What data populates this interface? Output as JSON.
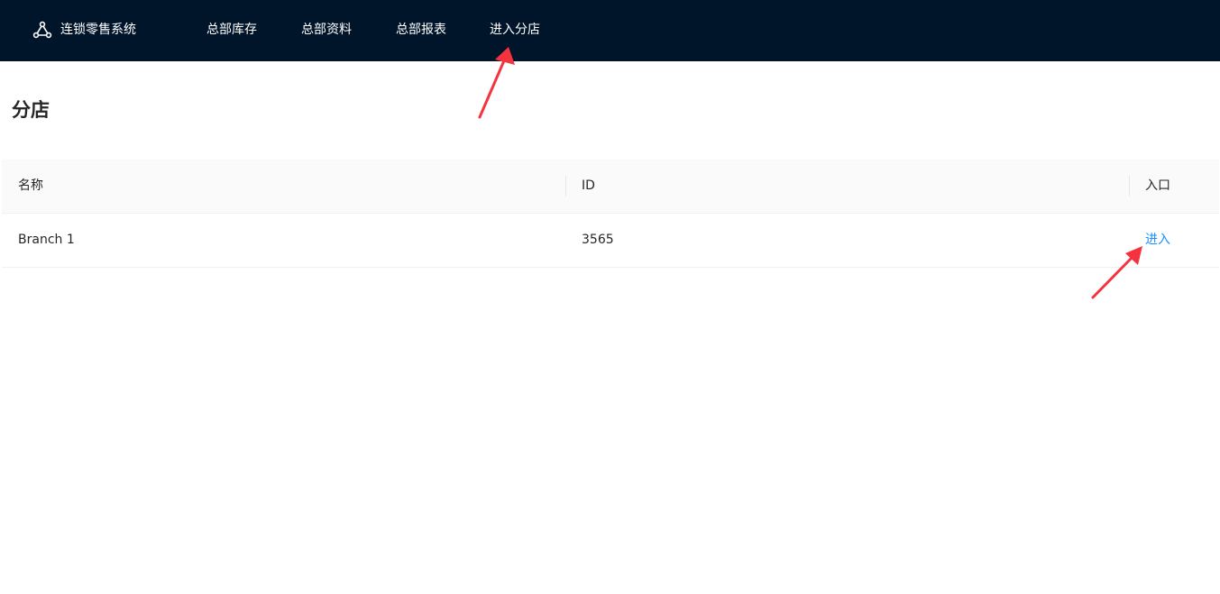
{
  "app": {
    "name": "连锁零售系统",
    "logo_icon": "branch-nodes-icon"
  },
  "nav": {
    "items": [
      {
        "label": "总部库存"
      },
      {
        "label": "总部资料"
      },
      {
        "label": "总部报表"
      },
      {
        "label": "进入分店"
      }
    ]
  },
  "page": {
    "title": "分店"
  },
  "table": {
    "columns": [
      "名称",
      "ID",
      "入口"
    ],
    "rows": [
      {
        "name": "Branch 1",
        "id": "3565",
        "action": "进入"
      }
    ]
  },
  "annotations": {
    "arrow_color": "#f5333f"
  },
  "colors": {
    "header_bg": "#001529",
    "link": "#1890ff",
    "table_header_bg": "#fafafa"
  }
}
